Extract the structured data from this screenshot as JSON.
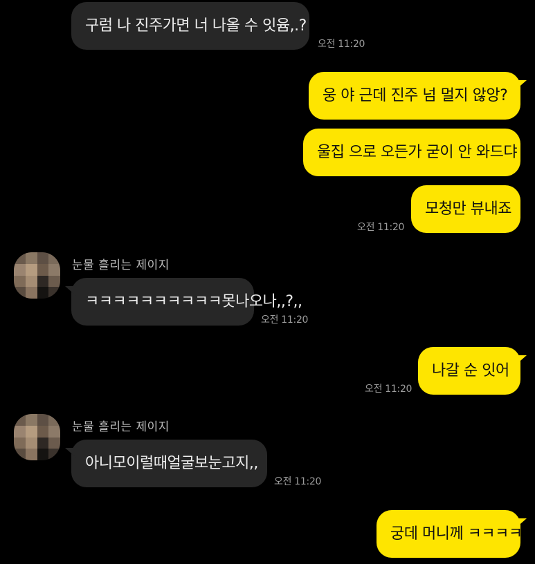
{
  "chat": {
    "contact_name": "눈물 흘리는 제이지",
    "messages": [
      {
        "id": "m1",
        "direction": "in",
        "text": "구럼 나 진주가면 너 나올 수 잇윰,.?",
        "time": "오전 11:20"
      },
      {
        "id": "m2",
        "direction": "out",
        "text": "웅  야 근데 진주 넘 멀지 않앙?"
      },
      {
        "id": "m3",
        "direction": "out",
        "text": "울집 으로 오든가 굳이 안 와드댜"
      },
      {
        "id": "m4",
        "direction": "out",
        "text": "모청만 뷰내죠",
        "time": "오전 11:20"
      },
      {
        "id": "m5",
        "direction": "in",
        "sender": "눈물 흘리는 제이지",
        "text": "ㅋㅋㅋㅋㅋㅋㅋㅋㅋㅋ못나오나,,?,,",
        "time": "오전 11:20"
      },
      {
        "id": "m6",
        "direction": "out",
        "text": "나갈 순 잇어",
        "time": "오전 11:20"
      },
      {
        "id": "m7",
        "direction": "in",
        "sender": "눈물 흘리는 제이지",
        "text": "아니모이럴때얼굴보눈고지,,",
        "time": "오전 11:20"
      },
      {
        "id": "m8",
        "direction": "out",
        "text": "궁데 머니께 ㅋㅋㅋㅋ"
      }
    ]
  },
  "colors": {
    "background": "#000000",
    "incoming_bubble": "#272727",
    "outgoing_bubble": "#fee500",
    "timestamp": "#9c9c9c"
  }
}
